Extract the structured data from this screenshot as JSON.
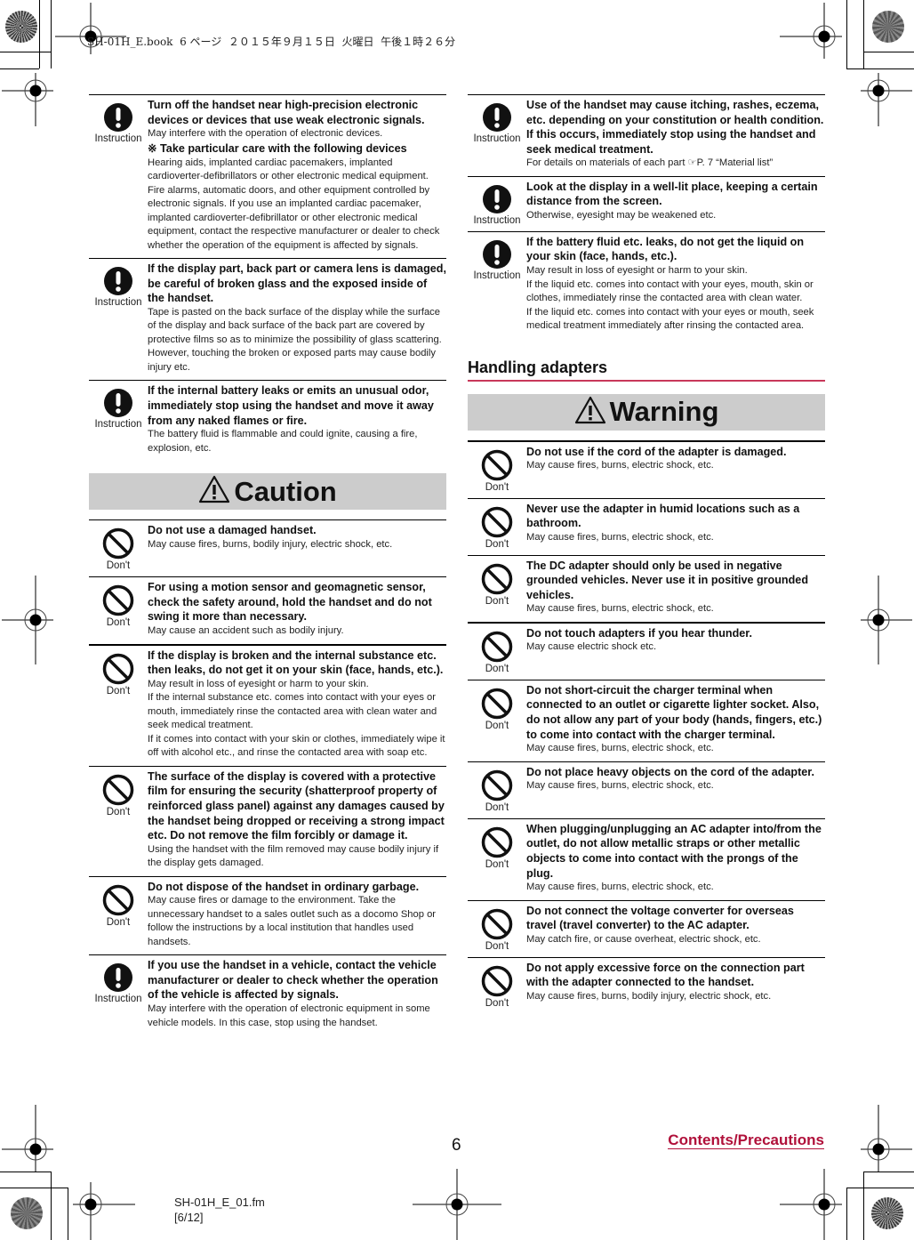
{
  "header": {
    "print_stamp": "SH-01H_E.book  6 ページ  ２０１５年９月１５日  火曜日  午後１時２６分"
  },
  "icons": {
    "instruction_label": "Instruction",
    "dont_label": "Don't"
  },
  "left_column": {
    "instruction_items_top": [
      {
        "title": "Turn off the handset near high-precision electronic devices or devices that use weak electronic signals.",
        "body": "May interfere with the operation of electronic devices.",
        "subhead": "※ Take particular care with the following devices",
        "body2": "Hearing aids, implanted cardiac pacemakers, implanted cardioverter-defibrillators or other electronic medical equipment. Fire alarms, automatic doors, and other equipment controlled by electronic signals. If you use an implanted cardiac pacemaker, implanted cardioverter-defibrillator or other electronic medical equipment, contact the respective manufacturer or dealer to check whether the operation of the equipment is affected by signals."
      },
      {
        "title": "If the display part, back part or camera lens is damaged, be careful of broken glass and the exposed inside of the handset.",
        "body": "Tape is pasted on the back surface of the display while the surface of the display and back surface of the back part are covered by protective films so as to minimize the possibility of glass scattering. However, touching the broken or exposed parts may cause bodily injury etc."
      },
      {
        "title": "If the internal battery leaks or emits an unusual odor, immediately stop using the handset and move it away from any naked flames or fire.",
        "body": "The battery fluid is flammable and could ignite, causing a fire, explosion, etc."
      }
    ],
    "caution_banner": "Caution",
    "caution_items": [
      {
        "title": "Do not use a damaged handset.",
        "body": "May cause fires, burns, bodily injury, electric shock, etc."
      },
      {
        "title": "For using a motion sensor and geomagnetic sensor, check the safety around, hold the handset and do not swing it more than necessary.",
        "body": "May cause an accident such as bodily injury."
      },
      {
        "title": "If the display is broken and the internal substance etc. then leaks, do not get it on your skin (face, hands, etc.).",
        "body": "May result in loss of eyesight or harm to your skin.\nIf the internal substance etc. comes into contact with your eyes or mouth, immediately rinse the contacted area with clean water and seek medical treatment.\nIf it comes into contact with your skin or clothes, immediately wipe it off with alcohol etc., and rinse the contacted area with soap etc."
      },
      {
        "title": "The surface of the display is covered with a protective film for ensuring the security (shatterproof property of reinforced glass panel) against any damages caused by the handset being dropped or receiving a strong impact etc. Do not remove the film forcibly or damage it.",
        "body": "Using the handset with the film removed may cause bodily injury if the display gets damaged."
      },
      {
        "title": "Do not dispose of the handset in ordinary garbage.",
        "body": "May cause fires or damage to the environment. Take the unnecessary handset to a sales outlet such as a docomo Shop or follow the instructions by a local institution that handles used handsets."
      }
    ],
    "instruction_item_bottom": {
      "title": "If you use the handset in a vehicle, contact the vehicle manufacturer or dealer to check whether the operation of the vehicle is affected by signals.",
      "body": "May interfere with the operation of electronic equipment in some vehicle models. In this case, stop using the handset."
    }
  },
  "right_column": {
    "instruction_items": [
      {
        "title": "Use of the handset may cause itching, rashes, eczema, etc. depending on your constitution or health condition. If this occurs, immediately stop using the handset and seek medical treatment.",
        "body": "For details on materials of each part ☞P. 7 “Material list”"
      },
      {
        "title": "Look at the display in a well-lit place, keeping a certain distance from the screen.",
        "body": "Otherwise, eyesight may be weakened etc."
      },
      {
        "title": "If the battery fluid etc. leaks, do not get the liquid on your skin (face, hands, etc.).",
        "body": "May result in loss of eyesight or harm to your skin.\nIf the liquid etc. comes into contact with your eyes, mouth, skin or clothes, immediately rinse the contacted area with clean water.\nIf the liquid etc. comes into contact with your eyes or mouth, seek medical treatment immediately after rinsing the contacted area."
      }
    ],
    "section_title": "Handling adapters",
    "warning_banner": "Warning",
    "warning_items": [
      {
        "title": "Do not use if the cord of the adapter is damaged.",
        "body": "May cause fires, burns, electric shock, etc."
      },
      {
        "title": "Never use the adapter in humid locations such as a bathroom.",
        "body": "May cause fires, burns, electric shock, etc."
      },
      {
        "title": "The DC adapter should only be used in negative grounded vehicles. Never use it in positive grounded vehicles.",
        "body": "May cause fires, burns, electric shock, etc."
      },
      {
        "title": "Do not touch adapters if you hear thunder.",
        "body": "May cause electric shock etc."
      },
      {
        "title": "Do not short-circuit the charger terminal when connected to an outlet or cigarette lighter socket. Also, do not allow any part of your body (hands, fingers, etc.) to come into contact with the charger terminal.",
        "body": "May cause fires, burns, electric shock, etc."
      },
      {
        "title": "Do not place heavy objects on the cord of the adapter.",
        "body": "May cause fires, burns, electric shock, etc."
      },
      {
        "title": "When plugging/unplugging an AC adapter into/from the outlet, do not allow metallic straps or other metallic objects to come into contact with the prongs of the plug.",
        "body": "May cause fires, burns, electric shock, etc."
      },
      {
        "title": "Do not connect the voltage converter for overseas travel (travel converter) to the AC adapter.",
        "body": "May catch fire, or cause overheat, electric shock, etc."
      },
      {
        "title": "Do not apply excessive force on the connection part with the adapter connected to the handset.",
        "body": "May cause fires, burns, bodily injury, electric shock, etc."
      }
    ]
  },
  "footer": {
    "page_number": "6",
    "section_link": "Contents/Precautions",
    "source_file": "SH-01H_E_01.fm",
    "page_range": "[6/12]"
  }
}
